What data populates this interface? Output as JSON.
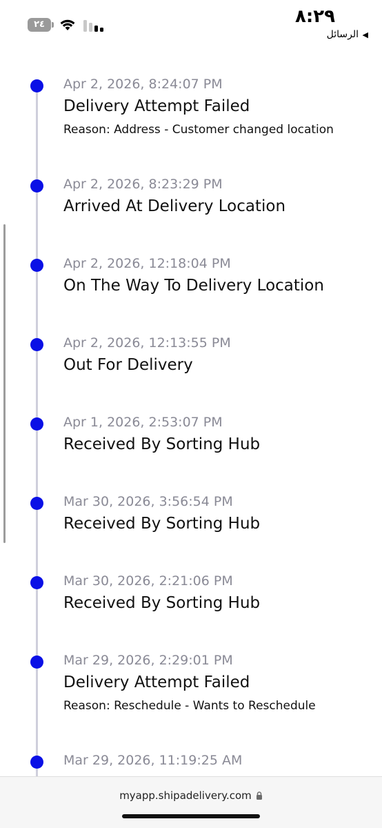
{
  "status_bar": {
    "time": "٨:٢٩",
    "back_label": "الرسائل",
    "back_arrow": "◀",
    "battery": "٢٤"
  },
  "events": [
    {
      "time": "Apr 2, 2026, 8:24:07 PM",
      "status": "Delivery Attempt Failed",
      "reason": "Reason: Address - Customer changed location"
    },
    {
      "time": "Apr 2, 2026, 8:23:29 PM",
      "status": "Arrived At Delivery Location",
      "reason": ""
    },
    {
      "time": "Apr 2, 2026, 12:18:04 PM",
      "status": "On The Way To Delivery Location",
      "reason": ""
    },
    {
      "time": "Apr 2, 2026, 12:13:55 PM",
      "status": "Out For Delivery",
      "reason": ""
    },
    {
      "time": "Apr 1, 2026, 2:53:07 PM",
      "status": "Received By Sorting Hub",
      "reason": ""
    },
    {
      "time": "Mar 30, 2026, 3:56:54 PM",
      "status": "Received By Sorting Hub",
      "reason": ""
    },
    {
      "time": "Mar 30, 2026, 2:21:06 PM",
      "status": "Received By Sorting Hub",
      "reason": ""
    },
    {
      "time": "Mar 29, 2026, 2:29:01 PM",
      "status": "Delivery Attempt Failed",
      "reason": "Reason: Reschedule - Wants to Reschedule"
    },
    {
      "time": "Mar 29, 2026, 11:19:25 AM",
      "status": "",
      "reason": ""
    }
  ],
  "url_bar": {
    "url": "myapp.shipadelivery.com"
  },
  "colors": {
    "dot": "#0a10e6",
    "timeline_line": "#cfcfdc",
    "timestamp": "#8a8a96"
  }
}
